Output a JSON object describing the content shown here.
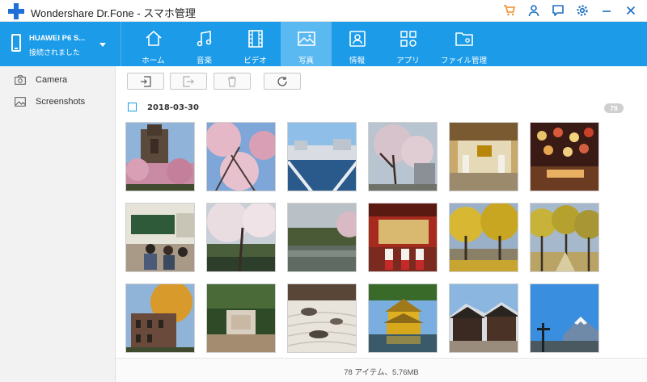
{
  "app": {
    "title": "Wondershare Dr.Fone - スマホ管理"
  },
  "device": {
    "name": "HUAWEI P6 S...",
    "status": "接続されました"
  },
  "tabs": [
    {
      "label": "ホーム",
      "icon": "home-icon"
    },
    {
      "label": "音楽",
      "icon": "music-icon"
    },
    {
      "label": "ビデオ",
      "icon": "video-icon"
    },
    {
      "label": "写真",
      "icon": "photo-icon",
      "active": true
    },
    {
      "label": "情報",
      "icon": "contacts-icon"
    },
    {
      "label": "アプリ",
      "icon": "apps-icon"
    },
    {
      "label": "ファイル管理",
      "icon": "folder-icon"
    }
  ],
  "sidebar": {
    "items": [
      {
        "label": "Camera",
        "icon": "camera-icon"
      },
      {
        "label": "Screenshots",
        "icon": "screenshots-icon"
      }
    ]
  },
  "toolbar": {
    "buttons": [
      "import-icon",
      "export-icon",
      "trash-icon",
      "refresh-icon"
    ]
  },
  "group": {
    "date": "2018-03-30",
    "count": "78"
  },
  "photos": [
    {
      "subject": "university-clock-tower"
    },
    {
      "subject": "cherry-blossom-sky"
    },
    {
      "subject": "canal-town-snow"
    },
    {
      "subject": "cherry-trees-buildings"
    },
    {
      "subject": "shrine-lanterns"
    },
    {
      "subject": "restaurant-lanterns"
    },
    {
      "subject": "classroom-students"
    },
    {
      "subject": "cherry-blossom-river"
    },
    {
      "subject": "lake-shore-trees"
    },
    {
      "subject": "shrine-maidens"
    },
    {
      "subject": "yellow-ginkgo-trees"
    },
    {
      "subject": "ginkgo-path"
    },
    {
      "subject": "old-brick-building"
    },
    {
      "subject": "stone-monument-forest"
    },
    {
      "subject": "zen-rock-garden"
    },
    {
      "subject": "golden-pavilion"
    },
    {
      "subject": "old-town-street"
    },
    {
      "subject": "mount-fuji-tower"
    }
  ],
  "statusbar": {
    "text": "78 アイテム、5.76MB"
  },
  "colors": {
    "accent": "#1b9be8",
    "active_tab": "#5ab9f1",
    "cart": "#f08a24"
  }
}
